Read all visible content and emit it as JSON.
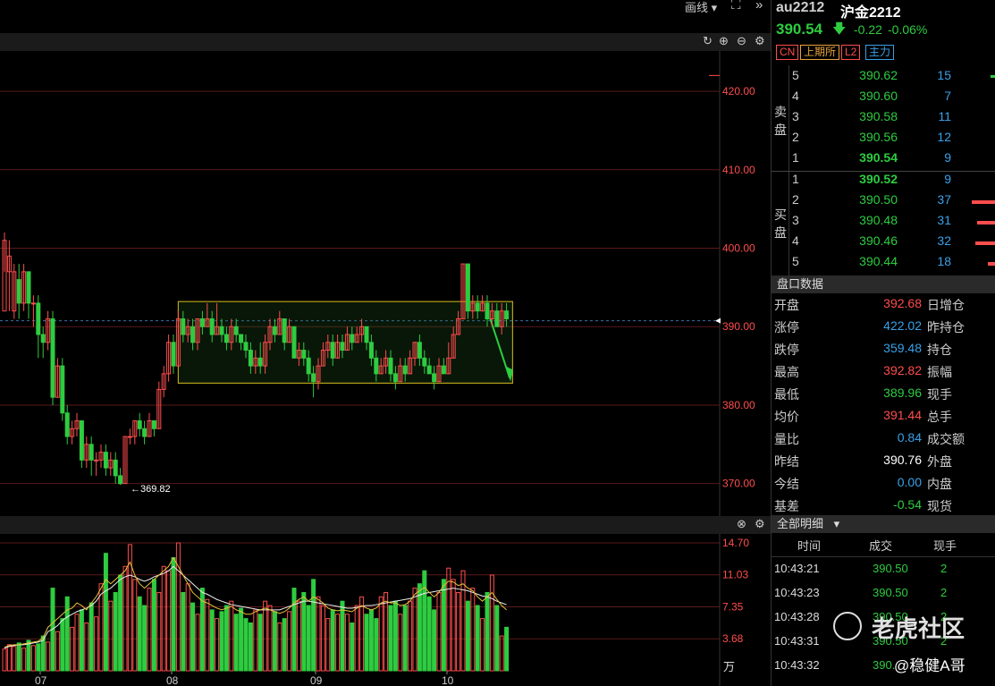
{
  "toolbar": {
    "draw_label": "画线",
    "draw_caret": "▾",
    "fullscreen_icon": "⛶",
    "more_icon": "»"
  },
  "chart_icons": {
    "reset": "↻",
    "zoom_in": "⊕",
    "zoom_out": "⊖",
    "settings": "⚙",
    "close": "⊗"
  },
  "price_axis": {
    "labels": [
      "420.00",
      "410.00",
      "400.00",
      "390.00",
      "380.00",
      "370.00"
    ],
    "low_marker": "←369.82"
  },
  "volume_axis": {
    "labels": [
      "14.70",
      "11.03",
      "7.35",
      "3.68"
    ],
    "unit": "万"
  },
  "date_labels": [
    "07",
    "08",
    "09",
    "10"
  ],
  "quote": {
    "code": "au2212",
    "name": "沪金2212",
    "price": "390.54",
    "arrow": "🡇",
    "change": "-0.22",
    "change_pct": "-0.06%",
    "badges": [
      {
        "text": "CN",
        "color": "#ff4d4d"
      },
      {
        "text": "上期所",
        "color": "#e8a33a"
      },
      {
        "text": "L2",
        "color": "#ff4d4d"
      },
      {
        "text": "主力",
        "color": "#3aa0e8"
      }
    ]
  },
  "orderbook": {
    "sell_label": "卖盘",
    "buy_label": "买盘",
    "asks": [
      {
        "level": "5",
        "price": "390.62",
        "vol": "15"
      },
      {
        "level": "4",
        "price": "390.60",
        "vol": "7"
      },
      {
        "level": "3",
        "price": "390.58",
        "vol": "11"
      },
      {
        "level": "2",
        "price": "390.56",
        "vol": "12"
      },
      {
        "level": "1",
        "price": "390.54",
        "vol": "9"
      }
    ],
    "bids": [
      {
        "level": "1",
        "price": "390.52",
        "vol": "9"
      },
      {
        "level": "2",
        "price": "390.50",
        "vol": "37"
      },
      {
        "level": "3",
        "price": "390.48",
        "vol": "31"
      },
      {
        "level": "4",
        "price": "390.46",
        "vol": "32"
      },
      {
        "level": "5",
        "price": "390.44",
        "vol": "18"
      }
    ]
  },
  "stats": {
    "title": "盘口数据",
    "rows": [
      {
        "label": "开盘",
        "value": "392.68",
        "color": "#ff4d4d",
        "label2": "日增仓"
      },
      {
        "label": "涨停",
        "value": "422.02",
        "color": "#3aa0e8",
        "label2": "昨持仓"
      },
      {
        "label": "跌停",
        "value": "359.48",
        "color": "#3aa0e8",
        "label2": "持仓"
      },
      {
        "label": "最高",
        "value": "392.82",
        "color": "#ff4d4d",
        "label2": "振幅"
      },
      {
        "label": "最低",
        "value": "389.96",
        "color": "#2ecc40",
        "label2": "现手"
      },
      {
        "label": "均价",
        "value": "391.44",
        "color": "#ff4d4d",
        "label2": "总手"
      },
      {
        "label": "量比",
        "value": "0.84",
        "color": "#3aa0e8",
        "label2": "成交额"
      },
      {
        "label": "昨结",
        "value": "390.76",
        "color": "#ffffff",
        "label2": "外盘"
      },
      {
        "label": "今结",
        "value": "0.00",
        "color": "#3aa0e8",
        "label2": "内盘"
      },
      {
        "label": "基差",
        "value": "-0.54",
        "color": "#2ecc40",
        "label2": "现货"
      }
    ]
  },
  "trades": {
    "title": "全部明细",
    "caret": "▾",
    "headers": [
      "时间",
      "成交",
      "现手"
    ],
    "rows": [
      {
        "time": "10:43:21",
        "price": "390.50",
        "vol": "2"
      },
      {
        "time": "10:43:23",
        "price": "390.50",
        "vol": "2"
      },
      {
        "time": "10:43:28",
        "price": "390.50",
        "vol": "2"
      },
      {
        "time": "10:43:31",
        "price": "390.50",
        "vol": "2"
      },
      {
        "time": "10:43:32",
        "price": "390.",
        "vol": ""
      }
    ]
  },
  "watermark": {
    "logo_text": "老虎社区",
    "author": "@稳健A哥"
  },
  "chart_data": {
    "type": "candlestick",
    "price_range": [
      367,
      424
    ],
    "consolidation_box": {
      "price_top": 393.2,
      "price_bottom": 382.8
    },
    "reference_price": 390.76,
    "candles": [
      [
        392,
        401,
        402,
        397
      ],
      [
        397,
        399,
        401,
        392
      ],
      [
        392,
        397,
        398,
        391
      ],
      [
        396,
        393,
        398,
        391
      ],
      [
        393,
        397,
        398,
        392
      ],
      [
        397,
        393,
        397,
        391
      ],
      [
        393,
        393,
        394,
        390
      ],
      [
        393,
        389,
        394,
        386
      ],
      [
        389,
        388,
        390,
        386
      ],
      [
        388,
        391,
        392,
        387
      ],
      [
        391,
        381,
        392,
        380
      ],
      [
        381,
        385,
        386,
        381
      ],
      [
        385,
        379,
        386,
        378
      ],
      [
        379,
        376,
        380,
        375
      ],
      [
        376,
        377,
        378,
        375
      ],
      [
        377,
        378,
        379,
        376
      ],
      [
        378,
        373,
        378,
        372
      ],
      [
        373,
        375,
        376,
        372
      ],
      [
        375,
        373,
        376,
        371
      ],
      [
        373,
        373,
        374,
        371
      ],
      [
        373,
        374,
        375,
        372
      ],
      [
        374,
        372,
        375,
        371
      ],
      [
        372,
        373,
        374,
        371
      ],
      [
        373,
        371,
        374,
        370
      ],
      [
        371,
        370,
        372,
        369.82
      ],
      [
        370,
        376,
        376,
        370
      ],
      [
        376,
        376,
        377,
        375
      ],
      [
        376,
        378,
        378,
        375
      ],
      [
        378,
        377,
        379,
        376
      ],
      [
        377,
        376,
        378,
        375
      ],
      [
        376,
        378,
        379,
        376
      ],
      [
        378,
        377,
        378,
        376
      ],
      [
        377,
        382,
        383,
        377
      ],
      [
        382,
        384,
        385,
        381
      ],
      [
        384,
        388,
        389,
        383
      ],
      [
        388,
        385,
        389,
        384
      ],
      [
        385,
        391,
        392,
        385
      ],
      [
        391,
        389,
        392,
        388
      ],
      [
        389,
        390,
        391,
        388
      ],
      [
        390,
        388,
        391,
        387
      ],
      [
        388,
        391,
        391,
        387
      ],
      [
        391,
        390,
        392,
        389
      ],
      [
        390,
        391,
        393,
        390
      ],
      [
        391,
        389,
        392,
        388
      ],
      [
        389,
        390,
        393,
        389
      ],
      [
        390,
        389,
        391,
        388
      ],
      [
        389,
        388,
        390,
        387
      ],
      [
        388,
        390,
        391,
        387
      ],
      [
        390,
        389,
        391,
        388
      ],
      [
        389,
        388,
        389,
        387
      ],
      [
        388,
        387,
        389,
        386
      ],
      [
        387,
        385,
        388,
        384
      ],
      [
        385,
        386,
        387,
        384
      ],
      [
        386,
        385,
        388,
        384
      ],
      [
        385,
        388,
        389,
        384
      ],
      [
        388,
        390,
        391,
        387
      ],
      [
        390,
        389,
        391,
        388
      ],
      [
        389,
        391,
        392,
        389
      ],
      [
        391,
        388,
        391,
        387
      ],
      [
        388,
        390,
        391,
        388
      ],
      [
        390,
        386,
        390,
        386
      ],
      [
        386,
        387,
        388,
        385
      ],
      [
        387,
        386,
        388,
        385
      ],
      [
        386,
        384,
        387,
        383
      ],
      [
        384,
        383,
        385,
        381
      ],
      [
        383,
        385,
        386,
        382
      ],
      [
        385,
        387,
        388,
        385
      ],
      [
        387,
        388,
        389,
        386
      ],
      [
        388,
        386,
        389,
        385
      ],
      [
        386,
        388,
        389,
        386
      ],
      [
        388,
        387,
        389,
        386
      ],
      [
        387,
        389,
        390,
        387
      ],
      [
        389,
        388,
        390,
        387
      ],
      [
        388,
        389,
        390,
        388
      ],
      [
        389,
        390,
        391,
        388
      ],
      [
        390,
        388,
        390,
        387
      ],
      [
        388,
        386,
        389,
        385
      ],
      [
        386,
        384,
        387,
        383
      ],
      [
        384,
        385,
        386,
        384
      ],
      [
        385,
        386,
        387,
        384
      ],
      [
        386,
        384,
        387,
        383
      ],
      [
        384,
        383,
        385,
        382
      ],
      [
        383,
        385,
        386,
        383
      ],
      [
        385,
        384,
        386,
        383
      ],
      [
        384,
        386,
        387,
        384
      ],
      [
        386,
        388,
        388,
        385
      ],
      [
        388,
        386,
        389,
        385
      ],
      [
        386,
        385,
        387,
        384
      ],
      [
        385,
        384,
        386,
        384
      ],
      [
        384,
        383,
        385,
        382
      ],
      [
        383,
        385,
        386,
        383
      ],
      [
        385,
        384,
        386,
        384
      ],
      [
        384,
        386,
        388,
        384
      ],
      [
        386,
        389,
        390,
        386
      ],
      [
        389,
        391,
        392,
        389
      ],
      [
        391,
        398,
        398,
        391
      ],
      [
        398,
        392,
        398,
        391
      ],
      [
        392,
        393,
        394,
        391
      ],
      [
        393,
        392,
        394,
        391
      ],
      [
        392,
        393,
        394,
        392
      ],
      [
        393,
        391,
        394,
        390
      ],
      [
        391,
        392,
        393,
        390
      ],
      [
        392,
        390,
        393,
        390
      ],
      [
        390,
        392,
        393,
        389
      ],
      [
        392,
        391,
        393,
        390
      ]
    ],
    "volumes": [
      2.5,
      3.0,
      2.8,
      3.2,
      2.6,
      3.5,
      2.9,
      3.1,
      4.0,
      3.3,
      9.5,
      4.5,
      6.0,
      8.5,
      5.0,
      6.5,
      7.0,
      5.5,
      7.8,
      6.2,
      10.0,
      13.5,
      8.0,
      9.0,
      11.0,
      12.0,
      14.5,
      10.5,
      8.5,
      7.5,
      9.5,
      10.5,
      9.0,
      12.0,
      11.5,
      13.0,
      14.7,
      9.0,
      10.0,
      7.8,
      6.5,
      9.5,
      8.2,
      7.0,
      6.0,
      6.8,
      7.5,
      8.0,
      6.5,
      7.2,
      6.0,
      5.5,
      7.0,
      6.5,
      8.0,
      7.5,
      6.8,
      5.5,
      6.0,
      6.8,
      9.5,
      8.0,
      9.0,
      7.5,
      10.5,
      8.5,
      7.5,
      6.0,
      7.0,
      6.5,
      8.0,
      6.5,
      5.5,
      7.5,
      8.5,
      6.5,
      7.0,
      6.0,
      8.5,
      9.0,
      7.5,
      8.0,
      6.5,
      7.5,
      8.0,
      9.5,
      10.0,
      11.5,
      8.5,
      7.0,
      9.0,
      10.5,
      11.8,
      10.5,
      9.0,
      11.5,
      8.0,
      9.5,
      7.5,
      6.0,
      9.0,
      11.0,
      7.5,
      4.0,
      5.0
    ],
    "ma_white": [
      2.6,
      2.8,
      2.9,
      3.0,
      3.0,
      3.1,
      3.2,
      3.3,
      3.5,
      4.5,
      4.8,
      5.2,
      5.8,
      6.2,
      6.5,
      6.8,
      7.0,
      7.2,
      7.5,
      8.0,
      8.8,
      9.2,
      9.5,
      10.0,
      10.5,
      10.8,
      11.0,
      10.8,
      10.5,
      10.3,
      10.5,
      10.8,
      11.0,
      11.2,
      11.5,
      12.0,
      11.5,
      11.0,
      10.5,
      10.0,
      9.5,
      9.0,
      8.8,
      8.5,
      8.2,
      8.0,
      7.8,
      7.6,
      7.5,
      7.4,
      7.3,
      7.2,
      7.1,
      7.0,
      7.0,
      7.0,
      7.0,
      7.0,
      7.2,
      7.4,
      7.6,
      7.8,
      8.0,
      8.0,
      7.9,
      7.8,
      7.7,
      7.6,
      7.5,
      7.4,
      7.3,
      7.2,
      7.2,
      7.3,
      7.4,
      7.5,
      7.5,
      7.6,
      7.7,
      7.8,
      7.9,
      8.0,
      8.1,
      8.2,
      8.3,
      8.5,
      8.7,
      8.9,
      9.0,
      9.1,
      9.2,
      9.3,
      9.4,
      9.5,
      9.4,
      9.3,
      9.2,
      9.0,
      8.8,
      8.6,
      8.5,
      8.3,
      8.0,
      7.8,
      7.6
    ],
    "ma_yellow": [
      2.7,
      2.9,
      3.0,
      3.0,
      3.1,
      3.2,
      3.3,
      3.4,
      3.8,
      5.0,
      5.5,
      6.0,
      6.5,
      7.0,
      7.2,
      7.8,
      7.5,
      7.0,
      7.8,
      8.5,
      9.5,
      10.5,
      10.0,
      10.5,
      11.0,
      11.5,
      12.5,
      11.0,
      10.0,
      9.5,
      10.0,
      10.5,
      11.0,
      11.5,
      12.0,
      13.0,
      12.0,
      11.0,
      10.0,
      9.0,
      8.5,
      8.0,
      7.8,
      7.5,
      7.2,
      7.0,
      7.2,
      7.4,
      7.0,
      6.8,
      6.5,
      6.5,
      6.8,
      7.0,
      7.2,
      7.0,
      6.8,
      6.6,
      6.8,
      7.2,
      7.8,
      8.2,
      8.5,
      8.0,
      8.5,
      8.2,
      7.8,
      7.2,
      7.0,
      6.9,
      7.0,
      6.9,
      6.8,
      7.2,
      7.5,
      7.2,
      7.0,
      7.2,
      7.8,
      8.0,
      7.8,
      7.8,
      7.5,
      7.6,
      8.0,
      8.8,
      9.2,
      9.6,
      9.0,
      8.5,
      9.0,
      9.8,
      10.3,
      10.2,
      9.8,
      10.0,
      9.5,
      9.2,
      8.5,
      8.0,
      8.5,
      9.0,
      8.2,
      7.5,
      7.0
    ]
  }
}
